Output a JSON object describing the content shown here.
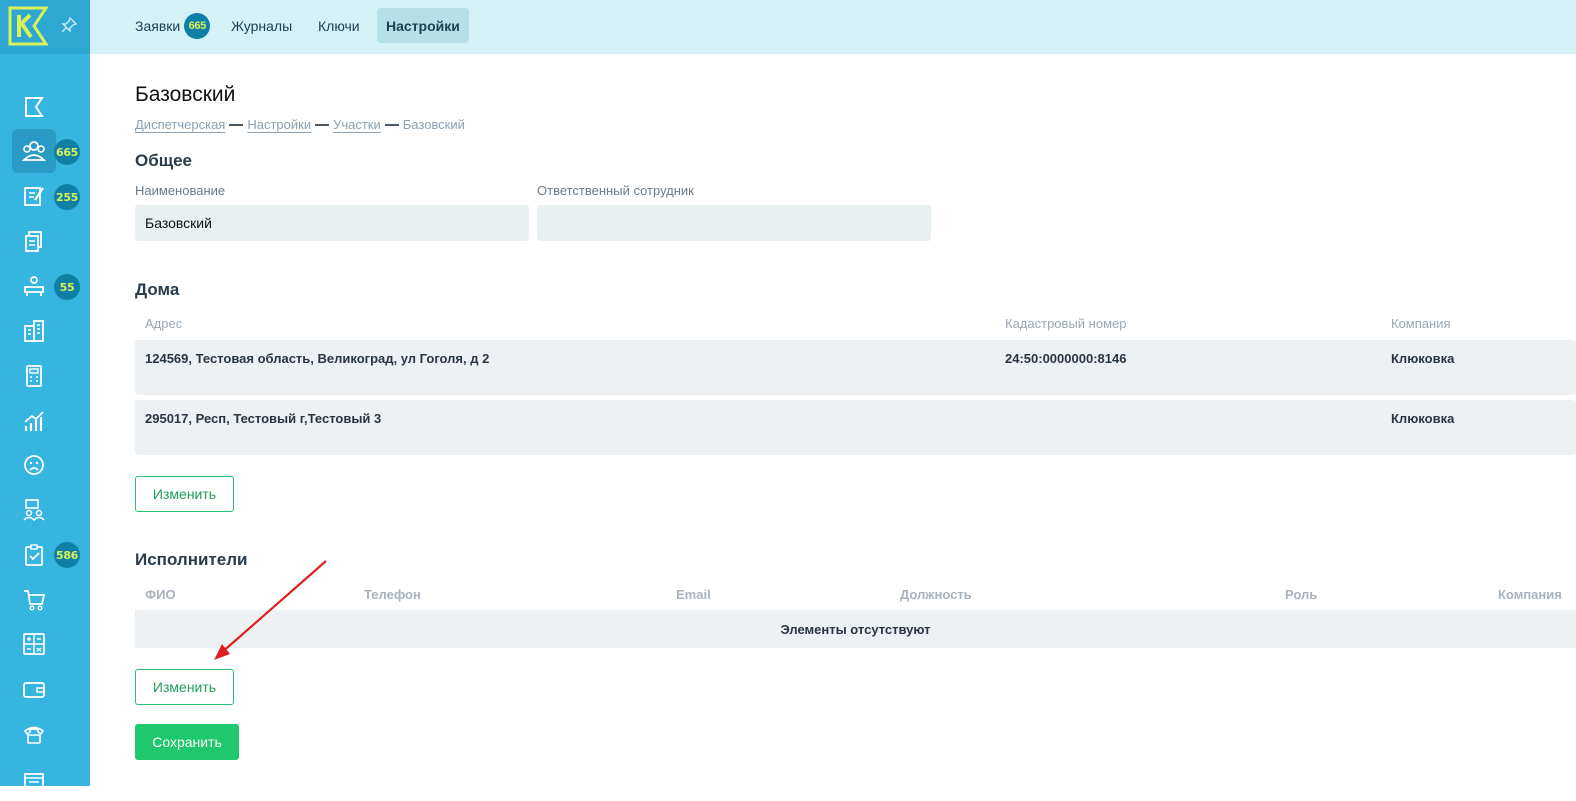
{
  "sidebar": {
    "badges": {
      "requests": "665",
      "journals": "255",
      "reception": "55",
      "tasks": "586"
    },
    "items": [
      {
        "icon": "flag-icon"
      },
      {
        "icon": "people-group-icon"
      },
      {
        "icon": "edit-note-icon"
      },
      {
        "icon": "documents-icon"
      },
      {
        "icon": "reception-desk-icon"
      },
      {
        "icon": "buildings-icon"
      },
      {
        "icon": "calculator-icon"
      },
      {
        "icon": "chart-growth-icon"
      },
      {
        "icon": "sad-face-icon"
      },
      {
        "icon": "team-board-icon"
      },
      {
        "icon": "clipboard-check-icon"
      },
      {
        "icon": "shopping-cart-icon"
      },
      {
        "icon": "math-board-icon"
      },
      {
        "icon": "wallet-icon"
      },
      {
        "icon": "telephone-icon"
      },
      {
        "icon": "window-icon"
      }
    ]
  },
  "topnav": {
    "tabs": [
      {
        "label": "Заявки",
        "badge": "665"
      },
      {
        "label": "Журналы"
      },
      {
        "label": "Ключи"
      },
      {
        "label": "Настройки"
      }
    ]
  },
  "page": {
    "title": "Базовский",
    "breadcrumb": [
      "Диспетчерская",
      "Настройки",
      "Участки",
      "Базовский"
    ]
  },
  "general": {
    "title": "Общее",
    "name_label": "Наименование",
    "name_value": "Базовский",
    "responsible_label": "Ответственный сотрудник",
    "responsible_value": ""
  },
  "houses": {
    "title": "Дома",
    "columns": [
      "Адрес",
      "Кадастровый номер",
      "Компания"
    ],
    "rows": [
      {
        "address": "124569, Тестовая область, Великоград, ул Гоголя, д 2",
        "cadastral": "24:50:0000000:8146",
        "company": "Клюковка"
      },
      {
        "address": "295017, Респ, Тестовый г,Тестовый 3",
        "cadastral": "",
        "company": "Клюковка"
      }
    ],
    "edit_label": "Изменить"
  },
  "executors": {
    "title": "Исполнители",
    "columns": [
      "ФИО",
      "Телефон",
      "Email",
      "Должность",
      "Роль",
      "Компания"
    ],
    "empty_text": "Элементы отсутствуют",
    "edit_label": "Изменить"
  },
  "save_label": "Сохранить",
  "colors": {
    "accent": "#1fc86d",
    "sidebar": "#35b5df",
    "badge": "#0f7fa3",
    "annotation": "#e02020"
  }
}
